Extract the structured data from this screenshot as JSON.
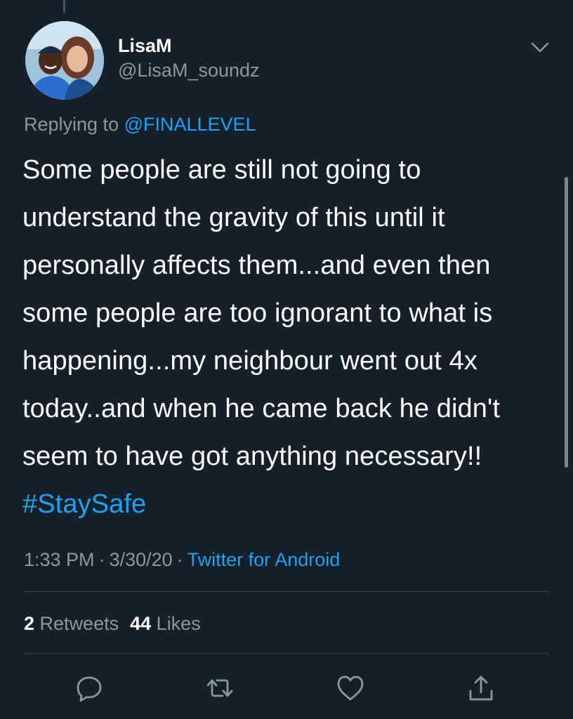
{
  "tweet": {
    "author": {
      "display_name": "LisaM",
      "handle": "@LisaM_soundz"
    },
    "reply": {
      "prefix": "Replying to ",
      "handle": "@FINALLEVEL"
    },
    "text": "Some people are still not going to understand the gravity of this until it personally affects them...and even then some people are too ignorant to what is happening...my neighbour went out 4x today..and when he came back he didn't seem to have got anything necessary!! ",
    "hashtag": "#StaySafe",
    "meta": {
      "time": "1:33 PM",
      "separator": "·",
      "date": "3/30/20",
      "source": "Twitter for Android"
    },
    "stats": {
      "retweets_count": "2",
      "retweets_label": "Retweets",
      "likes_count": "44",
      "likes_label": "Likes"
    },
    "actions": {
      "reply_icon": "reply-bubble-icon",
      "retweet_icon": "retweet-arrows-icon",
      "like_icon": "heart-icon",
      "share_icon": "share-upload-icon"
    }
  },
  "colors": {
    "background": "#15202b",
    "primary_text": "#ffffff",
    "secondary_text": "#8899a6",
    "accent": "#1da1f2",
    "divider": "#38444d"
  }
}
